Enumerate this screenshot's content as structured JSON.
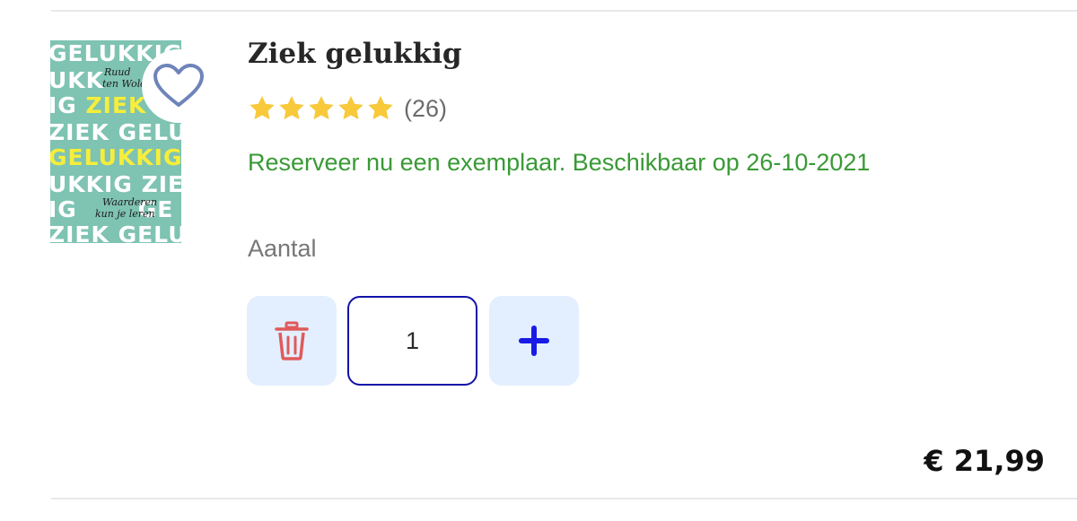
{
  "product": {
    "title": "Ziek gelukkig",
    "rating": 5,
    "rating_max": 5,
    "reviews": "(26)",
    "availability": "Reserveer nu een exemplaar. Beschikbaar op 26-10-2021",
    "price": "€ 21,99",
    "cover": {
      "author_line1": "Ruud",
      "author_line2": "ten Wolde",
      "subtitle_line1": "Waarderen",
      "subtitle_line2": "kun je leren",
      "background_color": "#7fc3b2",
      "highlight_color": "#f6ee3a"
    }
  },
  "quantity": {
    "label": "Aantal",
    "value": "1",
    "delete_icon": "trash-icon",
    "add_icon": "plus-icon"
  },
  "colors": {
    "availability": "#399a35",
    "star": "#f8c93b",
    "button_bg": "#e3efff",
    "input_border": "#1113a8",
    "trash": "#e05a5a",
    "plus": "#1a1ae6",
    "heart": "#6e84b9"
  }
}
